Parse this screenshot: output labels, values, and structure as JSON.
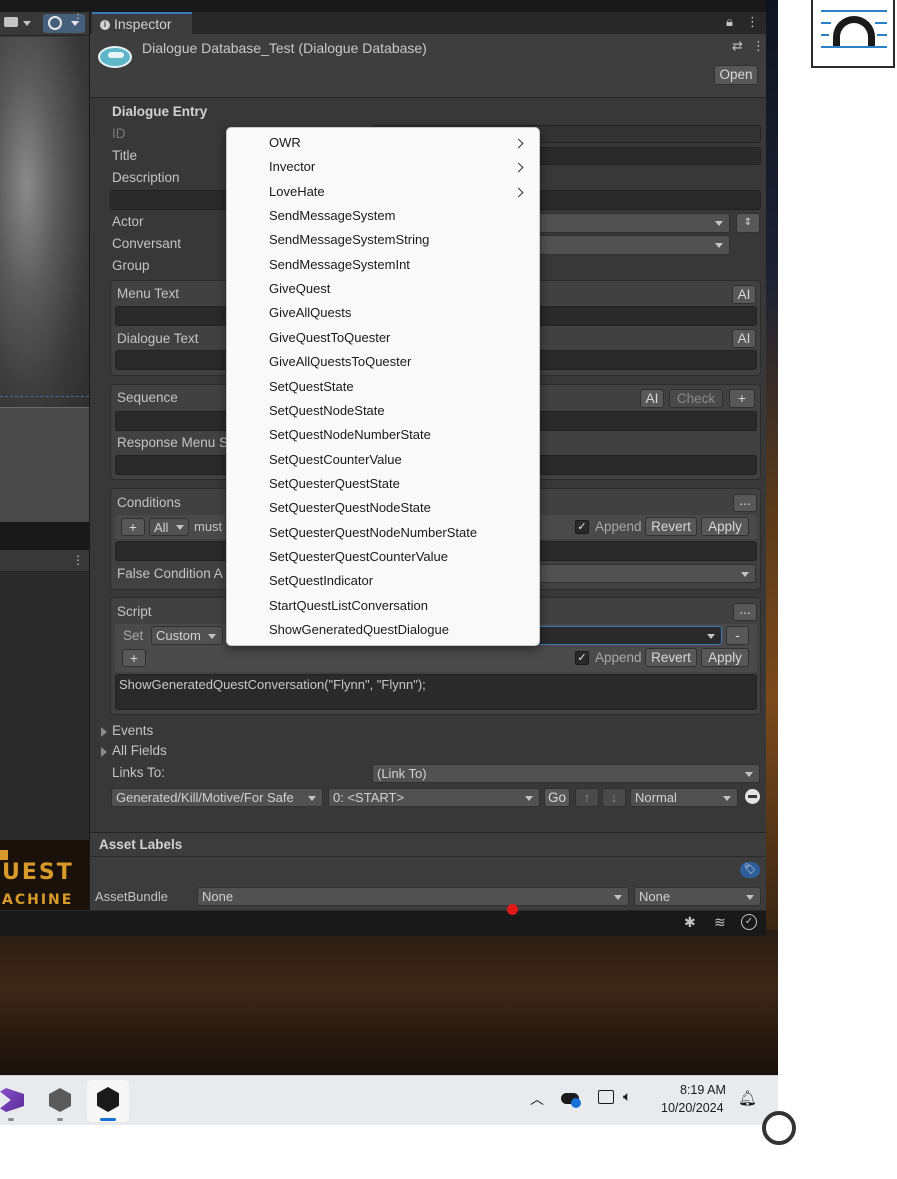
{
  "inspector": {
    "tab_label": "Inspector",
    "asset_title": "Dialogue Database_Test (Dialogue Database)",
    "open_button": "Open"
  },
  "entry": {
    "header": "Dialogue Entry",
    "id_label": "ID",
    "title_label": "Title",
    "description_label": "Description",
    "actor_label": "Actor",
    "conversant_label": "Conversant",
    "group_label": "Group",
    "menu_text_label": "Menu Text",
    "dialogue_text_label": "Dialogue Text",
    "ai_button": "AI",
    "sequence_label": "Sequence",
    "check_button": "Check",
    "plus_button": "+",
    "response_menu_label": "Response Menu S",
    "conditions_label": "Conditions",
    "ellipsis_button": "...",
    "all_dropdown": "All",
    "must_text": "must",
    "append_label": "Append",
    "revert_button": "Revert",
    "apply_button": "Apply",
    "false_condition_label": "False Condition A",
    "script_label": "Script",
    "set_label": "Set",
    "custom_dropdown": "Custom",
    "minus_button": "-",
    "script_value": "ShowGeneratedQuestConversation(\"Flynn\", \"Flynn\");",
    "events_label": "Events",
    "all_fields_label": "All Fields",
    "links_to_label": "Links To:",
    "link_to_dropdown": "(Link To)",
    "link_conversation": "Generated/Kill/Motive/For Safe",
    "link_entry": "0: <START>",
    "go_button": "Go",
    "priority_dropdown": "Normal"
  },
  "asset_labels": {
    "header": "Asset Labels",
    "assetbundle_label": "AssetBundle",
    "bundle_value": "None",
    "variant_value": "None"
  },
  "context_menu": {
    "items": [
      {
        "label": "OWR",
        "submenu": true
      },
      {
        "label": "Invector",
        "submenu": true
      },
      {
        "label": "LoveHate",
        "submenu": true
      },
      {
        "label": "SendMessageSystem",
        "submenu": false
      },
      {
        "label": "SendMessageSystemString",
        "submenu": false
      },
      {
        "label": "SendMessageSystemInt",
        "submenu": false
      },
      {
        "label": "GiveQuest",
        "submenu": false
      },
      {
        "label": "GiveAllQuests",
        "submenu": false
      },
      {
        "label": "GiveQuestToQuester",
        "submenu": false
      },
      {
        "label": "GiveAllQuestsToQuester",
        "submenu": false
      },
      {
        "label": "SetQuestState",
        "submenu": false
      },
      {
        "label": "SetQuestNodeState",
        "submenu": false
      },
      {
        "label": "SetQuestNodeNumberState",
        "submenu": false
      },
      {
        "label": "SetQuestCounterValue",
        "submenu": false
      },
      {
        "label": "SetQuesterQuestState",
        "submenu": false
      },
      {
        "label": "SetQuesterQuestNodeState",
        "submenu": false
      },
      {
        "label": "SetQuesterQuestNodeNumberState",
        "submenu": false
      },
      {
        "label": "SetQuesterQuestCounterValue",
        "submenu": false
      },
      {
        "label": "SetQuestIndicator",
        "submenu": false
      },
      {
        "label": "StartQuestListConversation",
        "submenu": false
      },
      {
        "label": "ShowGeneratedQuestDialogue",
        "submenu": false
      }
    ]
  },
  "game_logo": {
    "line1": "UEST",
    "line2": "ACHINE"
  },
  "taskbar": {
    "time": "8:19 AM",
    "date": "10/20/2024"
  },
  "colors": {
    "editor_bg": "#383838",
    "accent_blue": "#3a79bb",
    "logo_orange": "#d89a2a",
    "record_red": "#e01818"
  }
}
